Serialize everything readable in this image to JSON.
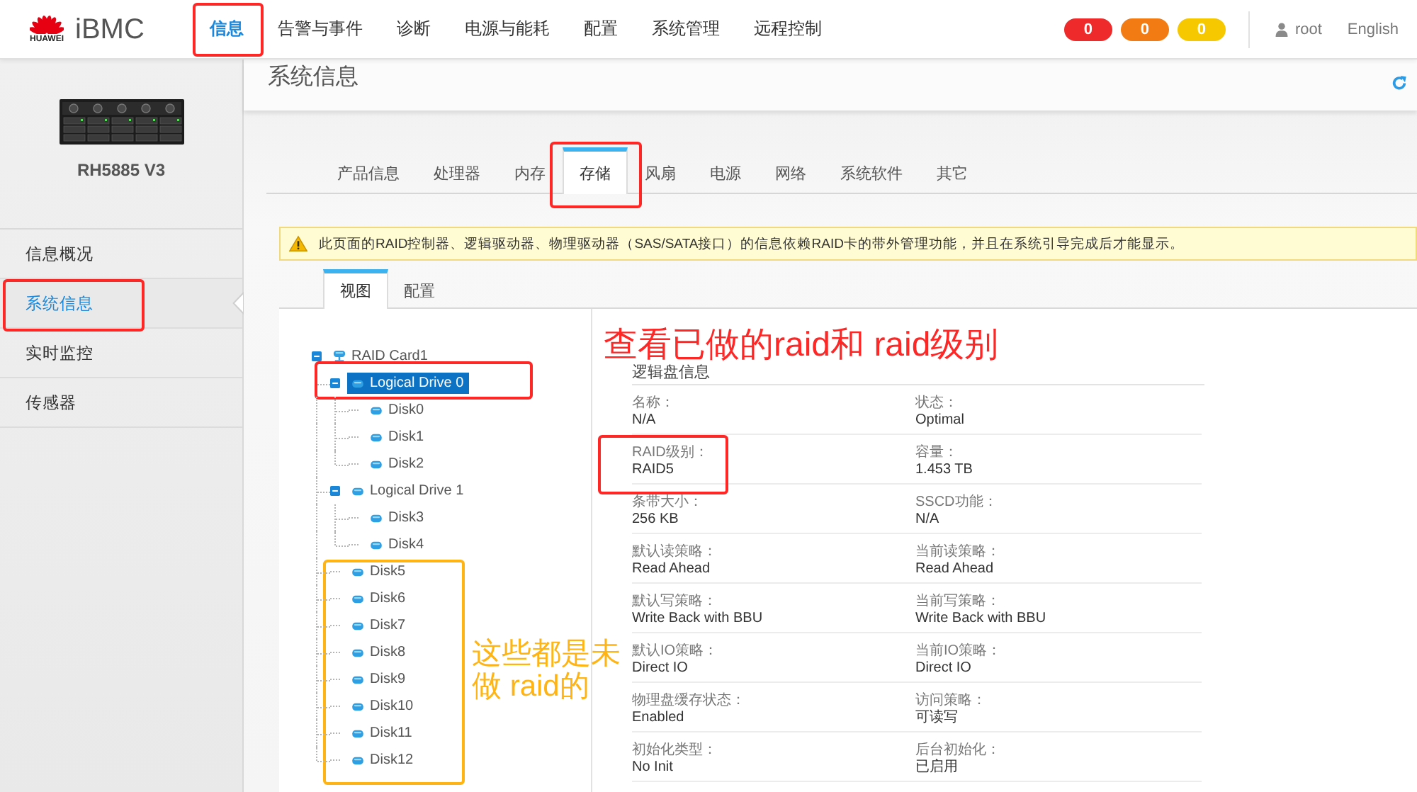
{
  "header": {
    "logo_text": "HUAWEI",
    "product": "iBMC",
    "nav": [
      {
        "label": "信息",
        "selected": true,
        "frame": {
          "color": "#ff2626"
        }
      },
      {
        "label": "告警与事件",
        "selected": false
      },
      {
        "label": "诊断",
        "selected": false
      },
      {
        "label": "电源与能耗",
        "selected": false
      },
      {
        "label": "配置",
        "selected": false
      },
      {
        "label": "系统管理",
        "selected": false
      },
      {
        "label": "远程控制",
        "selected": false
      }
    ],
    "alarm_counts": [
      {
        "count": "0",
        "color": "#ee2a2a"
      },
      {
        "count": "0",
        "color": "#f27b14"
      },
      {
        "count": "0",
        "color": "#f6c800"
      }
    ],
    "user": "root",
    "language": "English"
  },
  "sidebar": {
    "device_model": "RH5885 V3",
    "items": [
      {
        "label": "信息概况",
        "selected": false
      },
      {
        "label": "系统信息",
        "selected": true,
        "frame": {
          "color": "#ff2626"
        }
      },
      {
        "label": "实时监控",
        "selected": false
      },
      {
        "label": "传感器",
        "selected": false
      }
    ]
  },
  "page": {
    "title": "系统信息",
    "tabs": [
      {
        "label": "产品信息",
        "selected": false
      },
      {
        "label": "处理器",
        "selected": false
      },
      {
        "label": "内存",
        "selected": false
      },
      {
        "label": "存储",
        "selected": true,
        "frame": {
          "color": "#ff2626"
        }
      },
      {
        "label": "风扇",
        "selected": false
      },
      {
        "label": "电源",
        "selected": false
      },
      {
        "label": "网络",
        "selected": false
      },
      {
        "label": "系统软件",
        "selected": false
      },
      {
        "label": "其它",
        "selected": false
      }
    ],
    "warning": "此页面的RAID控制器、逻辑驱动器、物理驱动器（SAS/SATA接口）的信息依赖RAID卡的带外管理功能，并且在系统引导完成后才能显示。",
    "view_tabs": [
      {
        "label": "视图",
        "selected": true
      },
      {
        "label": "配置",
        "selected": false
      }
    ],
    "tree": {
      "group_frame": {
        "color": "#ffb414"
      },
      "note": {
        "text": "这些都是未做 raid的",
        "color": "#ffb414"
      },
      "nodes": [
        {
          "label": "RAID Card1",
          "kind": "controller",
          "expanded": true,
          "selected": false,
          "children": [
            {
              "label": "Logical Drive 0",
              "kind": "drive",
              "expanded": true,
              "selected": true,
              "frame": {
                "color": "#ff2626"
              },
              "children": [
                {
                  "label": "Disk0",
                  "kind": "drive",
                  "selected": false
                },
                {
                  "label": "Disk1",
                  "kind": "drive",
                  "selected": false
                },
                {
                  "label": "Disk2",
                  "kind": "drive",
                  "selected": false
                }
              ]
            },
            {
              "label": "Logical Drive 1",
              "kind": "drive",
              "expanded": true,
              "selected": false,
              "children": [
                {
                  "label": "Disk3",
                  "kind": "drive",
                  "selected": false
                },
                {
                  "label": "Disk4",
                  "kind": "drive",
                  "selected": false
                }
              ]
            },
            {
              "label": "Disk5",
              "kind": "drive",
              "selected": false
            },
            {
              "label": "Disk6",
              "kind": "drive",
              "selected": false
            },
            {
              "label": "Disk7",
              "kind": "drive",
              "selected": false
            },
            {
              "label": "Disk8",
              "kind": "drive",
              "selected": false
            },
            {
              "label": "Disk9",
              "kind": "drive",
              "selected": false
            },
            {
              "label": "Disk10",
              "kind": "drive",
              "selected": false
            },
            {
              "label": "Disk11",
              "kind": "drive",
              "selected": false
            },
            {
              "label": "Disk12",
              "kind": "drive",
              "selected": false
            }
          ]
        }
      ]
    },
    "details": {
      "note": {
        "text": "查看已做的raid和 raid级别",
        "color": "#ff2626"
      },
      "title": "逻辑盘信息",
      "fields": [
        {
          "label": "名称：",
          "value": "N/A"
        },
        {
          "label": "状态：",
          "value": "Optimal"
        },
        {
          "label": "RAID级别：",
          "value": "RAID5",
          "frame": {
            "color": "#ff2626"
          }
        },
        {
          "label": "容量：",
          "value": "1.453 TB"
        },
        {
          "label": "条带大小：",
          "value": "256 KB"
        },
        {
          "label": "SSCD功能：",
          "value": "N/A"
        },
        {
          "label": "默认读策略：",
          "value": "Read Ahead"
        },
        {
          "label": "当前读策略：",
          "value": "Read Ahead"
        },
        {
          "label": "默认写策略：",
          "value": "Write Back with BBU"
        },
        {
          "label": "当前写策略：",
          "value": "Write Back with BBU"
        },
        {
          "label": "默认IO策略：",
          "value": "Direct IO"
        },
        {
          "label": "当前IO策略：",
          "value": "Direct IO"
        },
        {
          "label": "物理盘缓存状态：",
          "value": "Enabled"
        },
        {
          "label": "访问策略：",
          "value": "可读写"
        },
        {
          "label": "初始化类型：",
          "value": "No Init"
        },
        {
          "label": "后台初始化：",
          "value": "已启用"
        }
      ]
    }
  }
}
